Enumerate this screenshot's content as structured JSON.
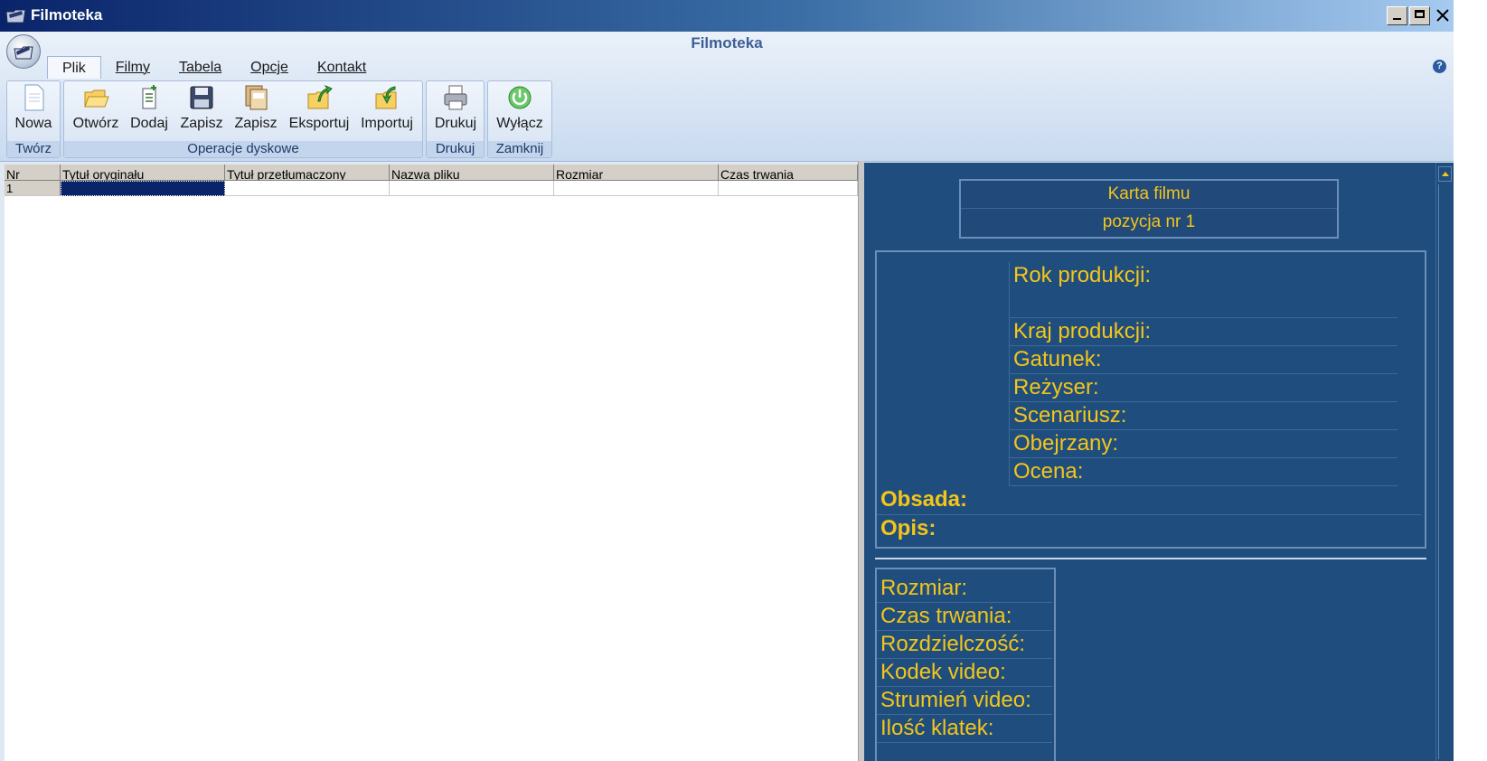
{
  "window": {
    "title": "Filmoteka",
    "controls": [
      "minimize",
      "maximize",
      "close"
    ]
  },
  "ribbon": {
    "app_title": "Filmoteka",
    "tabs": [
      {
        "label": "Plik",
        "active": true
      },
      {
        "label": "Filmy",
        "active": false
      },
      {
        "label": "Tabela",
        "active": false
      },
      {
        "label": "Opcje",
        "active": false
      },
      {
        "label": "Kontakt",
        "active": false
      }
    ],
    "groups": [
      {
        "label": "Twórz",
        "tools": [
          {
            "label": "Nowa",
            "icon": "new-document-icon"
          }
        ]
      },
      {
        "label": "Operacje dyskowe",
        "tools": [
          {
            "label": "Otwórz",
            "icon": "folder-open-icon"
          },
          {
            "label": "Dodaj",
            "icon": "add-document-icon"
          },
          {
            "label": "Zapisz",
            "icon": "floppy-disk-icon"
          },
          {
            "label": "Zapisz",
            "icon": "save-as-icon"
          },
          {
            "label": "Eksportuj",
            "icon": "folder-export-icon"
          },
          {
            "label": "Importuj",
            "icon": "folder-import-icon"
          }
        ]
      },
      {
        "label": "Drukuj",
        "tools": [
          {
            "label": "Drukuj",
            "icon": "printer-icon"
          }
        ]
      },
      {
        "label": "Zamknij",
        "tools": [
          {
            "label": "Wyłącz",
            "icon": "power-icon"
          }
        ]
      }
    ],
    "help_symbol": "?"
  },
  "table": {
    "columns": [
      "Nr",
      "Tytuł oryginału",
      "Tytuł przetłumaczony",
      "Nazwa pliku",
      "Rozmiar",
      "Czas trwania"
    ],
    "rows": [
      {
        "nr": "1",
        "cells": [
          "",
          "",
          "",
          "",
          ""
        ]
      }
    ]
  },
  "card": {
    "title": "Karta filmu",
    "subtitle": "pozycja nr 1",
    "fields": [
      "Rok produkcji:",
      "Kraj produkcji:",
      "Gatunek:",
      "Reżyser:",
      "Scenariusz:",
      "Obejrzany:",
      "Ocena:"
    ],
    "cast_label": "Obsada:",
    "description_label": "Opis:",
    "tech_fields": [
      "Rozmiar:",
      "Czas trwania:",
      "Rozdzielczość:",
      "Kodek video:",
      "Strumień video:",
      "Ilość klatek:"
    ],
    "colors": {
      "background": "#1f4e7e",
      "text": "#f5c518"
    }
  }
}
